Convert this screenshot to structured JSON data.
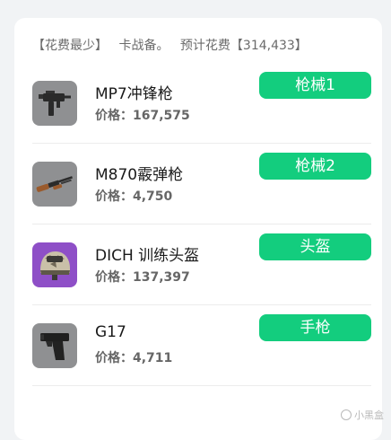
{
  "summary": {
    "strategy": "【花费最少】",
    "note": "卡战备。",
    "total_label": "预计花费【314,433】"
  },
  "items": [
    {
      "name": "MP7冲锋枪",
      "price_label": "价格：",
      "price": "167,575",
      "tag": "枪械1",
      "icon": "smg-icon"
    },
    {
      "name": "M870霰弹枪",
      "price_label": "价格：",
      "price": "4,750",
      "tag": "枪械2",
      "icon": "shotgun-icon"
    },
    {
      "name": "DICH 训练头盔",
      "price_label": "价格：",
      "price": "137,397",
      "tag": "头盔",
      "icon": "helmet-icon"
    },
    {
      "name": "G17",
      "price_label": "价格：",
      "price": "4,711",
      "tag": "手枪",
      "icon": "pistol-icon"
    }
  ],
  "watermark": "小黑盒",
  "colors": {
    "accent": "#13cd7e",
    "card": "#ffffff",
    "background": "#f1f3f5",
    "helmet_bg": "#8e4fc7"
  }
}
